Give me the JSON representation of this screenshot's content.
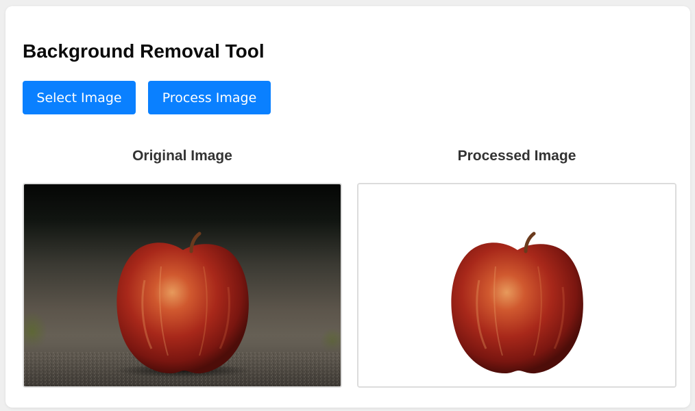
{
  "tool": {
    "title": "Background Removal Tool"
  },
  "toolbar": {
    "select_label": "Select Image",
    "process_label": "Process Image"
  },
  "panels": {
    "original": {
      "heading": "Original Image"
    },
    "processed": {
      "heading": "Processed Image"
    }
  },
  "colors": {
    "accent": "#0a80ff",
    "page_background": "#efefef",
    "card_background": "#ffffff",
    "heading_text": "#333333",
    "frame_border": "#dcdcdc",
    "apple_red": "#a8281a",
    "apple_stem": "#6b3a1d"
  },
  "icons": {
    "original_picture": "apple-photo-with-background",
    "processed_picture": "apple-photo-background-removed"
  }
}
